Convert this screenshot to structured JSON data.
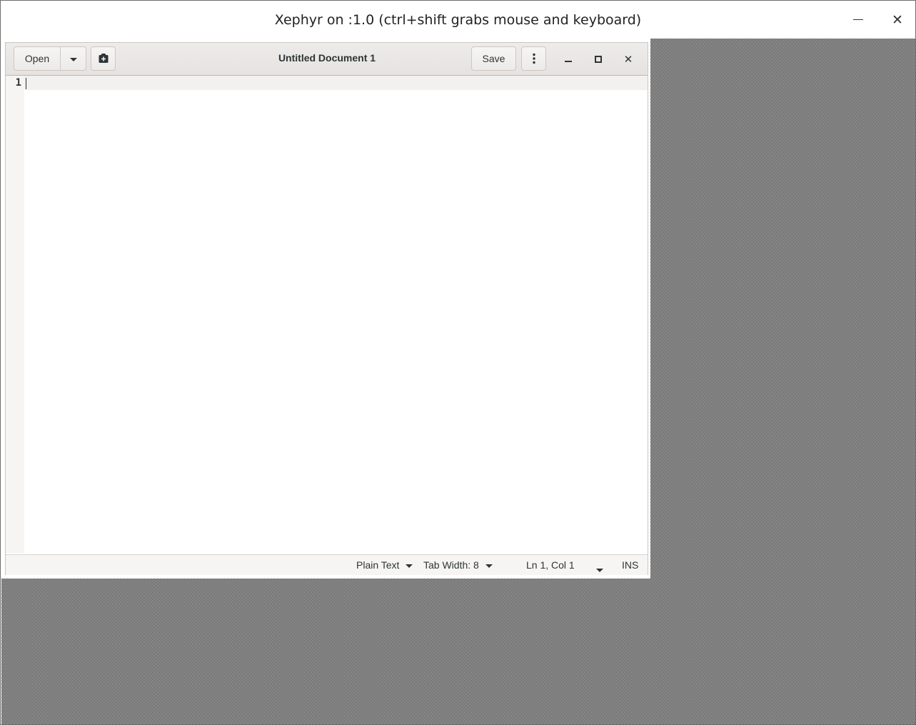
{
  "xephyr": {
    "title": "Xephyr on :1.0 (ctrl+shift grabs mouse and keyboard)",
    "minimize_icon": "minimize-line-icon",
    "close_label": "✕"
  },
  "gedit": {
    "header": {
      "open_label": "Open",
      "open_menu_icon": "chevron-down-icon",
      "new_document_icon": "new-document-icon",
      "title": "Untitled Document 1",
      "save_label": "Save",
      "menu_icon": "vertical-dots-icon",
      "close_label": "✕"
    },
    "editor": {
      "line_numbers": [
        "1"
      ],
      "content": ""
    },
    "statusbar": {
      "language": "Plain Text",
      "tab_width": "Tab Width: 8",
      "position": "Ln 1, Col 1",
      "mode": "INS"
    }
  }
}
